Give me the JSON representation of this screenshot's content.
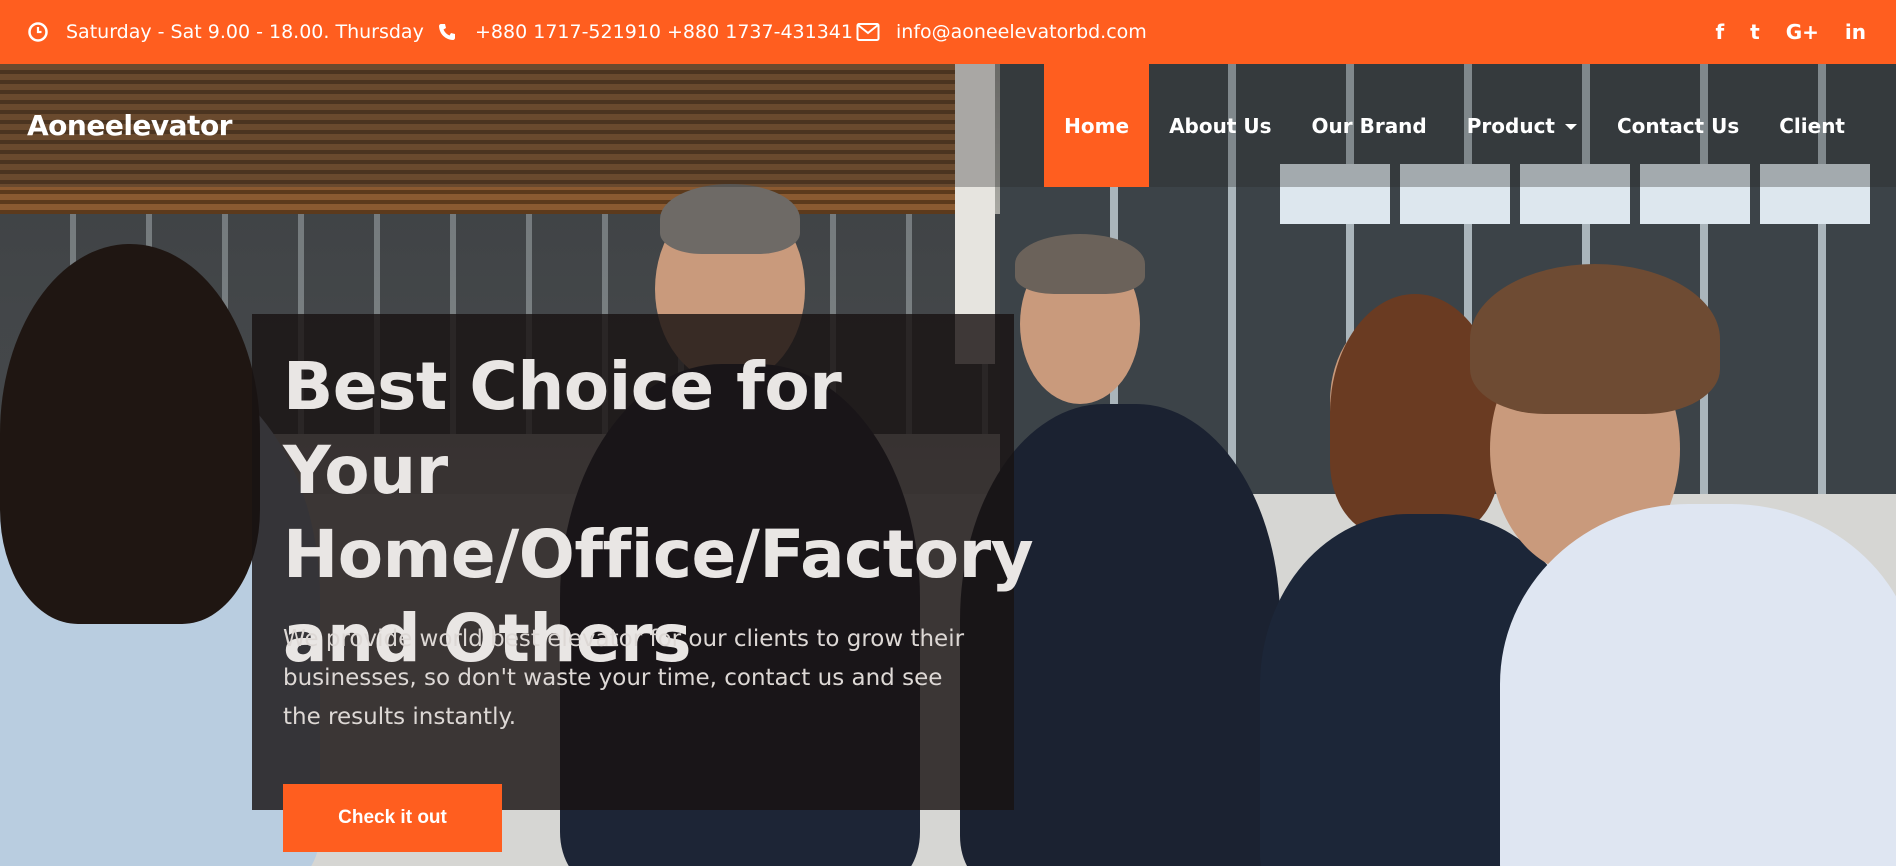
{
  "topbar": {
    "hours": "Saturday - Sat 9.00 - 18.00. Thursday",
    "phone": "+880 1717-521910 +880 1737-431341",
    "email": "info@aoneelevatorbd.com",
    "social": [
      {
        "name": "facebook-icon",
        "glyph": "f"
      },
      {
        "name": "twitter-icon",
        "glyph": "t"
      },
      {
        "name": "google-plus-icon",
        "glyph": "G+"
      },
      {
        "name": "linkedin-icon",
        "glyph": "in"
      }
    ]
  },
  "header": {
    "logo": "Aoneelevator",
    "nav": [
      {
        "label": "Home",
        "active": true
      },
      {
        "label": "About Us"
      },
      {
        "label": "Our Brand"
      },
      {
        "label": "Product",
        "dropdown": true
      },
      {
        "label": "Contact Us"
      },
      {
        "label": "Client"
      }
    ]
  },
  "hero": {
    "title_lines": [
      "Best Choice for Your",
      "Home/Office/Factory",
      "and Others"
    ],
    "description": "We provide world best elevator for our clients to grow their businesses, so don't waste your time, contact us and see the results instantly.",
    "cta": "Check it out"
  },
  "colors": {
    "accent": "#ff5e1f"
  }
}
